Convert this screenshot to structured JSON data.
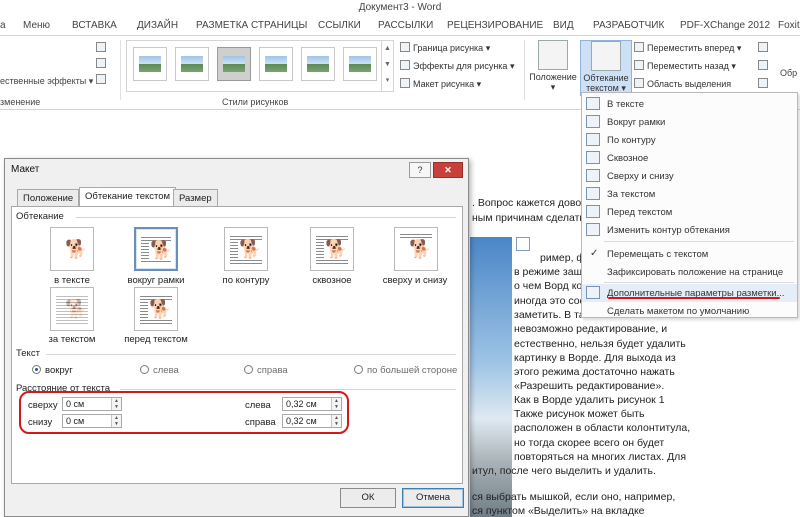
{
  "window": {
    "title": "Документ3 - Word"
  },
  "ribbon_tabs": [
    "а",
    "Меню",
    "ВСТАВКА",
    "ДИЗАЙН",
    "РАЗМЕТКА СТРАНИЦЫ",
    "ССЫЛКИ",
    "РАССЫЛКИ",
    "РЕЦЕНЗИРОВАНИЕ",
    "ВИД",
    "РАЗРАБОТЧИК",
    "PDF-XChange 2012",
    "Foxit"
  ],
  "ribbon": {
    "effects_label": "ественные эффекты",
    "group_left_label": "зменение",
    "picture_border": "Граница рисунка",
    "picture_effects": "Эффекты для рисунка",
    "picture_layout": "Макет рисунка",
    "styles_group": "Стили рисунков",
    "position_label": "Положение",
    "wrap_label_1": "Обтекание",
    "wrap_label_2": "текстом",
    "bring_forward": "Переместить вперед",
    "send_backward": "Переместить назад",
    "selection_pane": "Область выделения",
    "right_cut": "Обр"
  },
  "wrap_menu": {
    "items": [
      "В тексте",
      "Вокруг рамки",
      "По контуру",
      "Сквозное",
      "Сверху и снизу",
      "За текстом",
      "Перед текстом",
      "Изменить контур обтекания",
      "Перемещать с текстом",
      "Зафиксировать положение на странице",
      "Дополнительные параметры разметки...",
      "Сделать макетом по умолчанию"
    ]
  },
  "document": {
    "lines": [
      ". Вопрос кажется довол",
      "ным причинам сделать",
      "ример, фа",
      "в режиме защ",
      "о чем Ворд ко",
      "иногда это сос",
      "заметить. В та",
      "невозможно редактирование, и",
      "естественно, нельзя будет удалить",
      "картинку в Ворде. Для выхода из",
      "этого режима достаточно нажать",
      "«Разрешить редактирование».",
      "Как в Ворде удалить рисунок 1",
      "Также рисунок может быть",
      "расположен в области колонтитула,",
      "но тогда скорее всего он будет",
      "повторяться на многих листах. Для",
      "итул, после чего выделить и удалить.",
      "ся выбрать мышкой, если оно, например,",
      "ся пунктом «Выделить» на вкладке"
    ]
  },
  "dialog": {
    "title": "Макет",
    "help": "?",
    "close": "✕",
    "tabs": [
      "Положение",
      "Обтекание текстом",
      "Размер"
    ],
    "wrap_section": "Обтекание",
    "wrap_options": [
      "в тексте",
      "вокруг рамки",
      "по контуру",
      "сквозное",
      "сверху и снизу",
      "за текстом",
      "перед текстом"
    ],
    "text_section": "Текст",
    "text_options": [
      "вокруг",
      "слева",
      "справа",
      "по большей стороне"
    ],
    "distance_section": "Расстояние от текста",
    "distance": {
      "top_label": "сверху",
      "top_value": "0 см",
      "bottom_label": "снизу",
      "bottom_value": "0 см",
      "left_label": "слева",
      "left_value": "0,32 см",
      "right_label": "справа",
      "right_value": "0,32 см"
    },
    "ok": "ОК",
    "cancel": "Отмена"
  },
  "icons": {
    "dog": "🐕",
    "check": "✓",
    "up": "▲",
    "down": "▼",
    "dropdown": "▾"
  },
  "colors": {
    "accent": "#2b579a",
    "highlight_red": "#d21a1a"
  }
}
